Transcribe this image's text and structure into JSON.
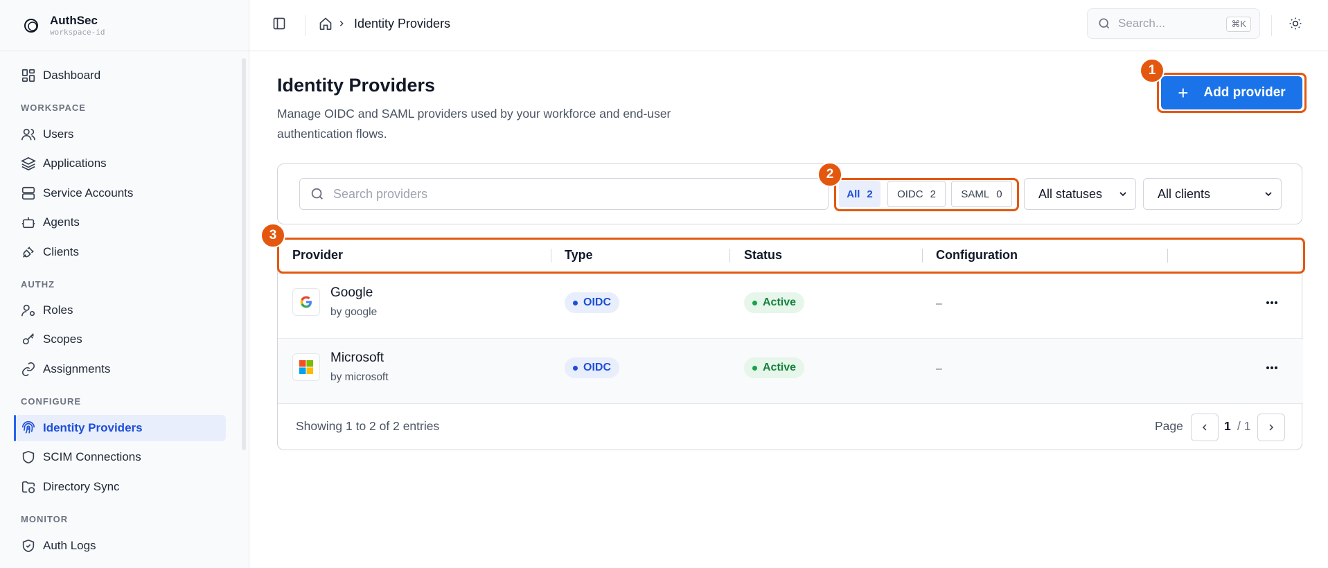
{
  "brand": {
    "name": "AuthSec",
    "workspace": "workspace-id"
  },
  "sidebar": {
    "dashboard": "Dashboard",
    "sections": {
      "workspace": "WORKSPACE",
      "authz": "AUTHZ",
      "configure": "CONFIGURE",
      "monitor": "MONITOR"
    },
    "items": {
      "users": "Users",
      "applications": "Applications",
      "service_accounts": "Service Accounts",
      "agents": "Agents",
      "clients": "Clients",
      "roles": "Roles",
      "scopes": "Scopes",
      "assignments": "Assignments",
      "identity_providers": "Identity Providers",
      "scim": "SCIM Connections",
      "directory_sync": "Directory Sync",
      "auth_logs": "Auth Logs"
    },
    "active": "identity_providers"
  },
  "topbar": {
    "breadcrumb_current": "Identity Providers",
    "search_placeholder": "Search...",
    "search_shortcut": "⌘K"
  },
  "page": {
    "title": "Identity Providers",
    "description": "Manage OIDC and SAML providers used by your workforce and end-user authentication flows.",
    "add_button": "Add provider"
  },
  "filters": {
    "search_placeholder": "Search providers",
    "segments": [
      {
        "label": "All",
        "count": "2",
        "active": true
      },
      {
        "label": "OIDC",
        "count": "2",
        "active": false
      },
      {
        "label": "SAML",
        "count": "0",
        "active": false
      }
    ],
    "status_select": "All statuses",
    "client_select": "All clients"
  },
  "table": {
    "columns": [
      "Provider",
      "Type",
      "Status",
      "Configuration"
    ],
    "rows": [
      {
        "name": "Google",
        "by": "by google",
        "type": "OIDC",
        "status": "Active",
        "configuration": "–",
        "logo": "google-logo"
      },
      {
        "name": "Microsoft",
        "by": "by microsoft",
        "type": "OIDC",
        "status": "Active",
        "configuration": "–",
        "logo": "microsoft-logo"
      }
    ],
    "footer": {
      "showing": "Showing 1 to 2 of 2 entries",
      "page_label": "Page",
      "page_current": "1",
      "page_total": "/ 1"
    }
  },
  "annotations": [
    "1",
    "2",
    "3"
  ],
  "colors": {
    "accent": "#1a73e8",
    "active_nav_bg": "#e8eefc",
    "status_active": "#15803d",
    "annotation": "#e4570e"
  },
  "icons": {
    "sidebar_toggle": "sidebar-toggle-icon",
    "home": "home-icon",
    "search": "search-icon",
    "theme": "sun-icon",
    "more": "more-horizontal-icon"
  }
}
